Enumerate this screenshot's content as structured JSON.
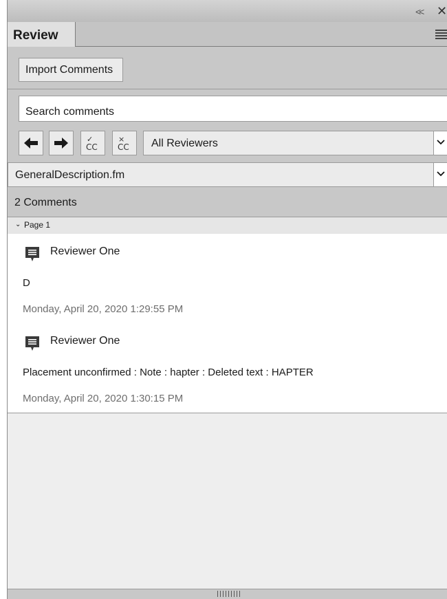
{
  "window": {
    "collapse_glyph": "<<",
    "close_glyph": "✕"
  },
  "tabs": {
    "active": "Review"
  },
  "toolbar": {
    "import_label": "Import Comments"
  },
  "search": {
    "placeholder": "Search comments"
  },
  "nav": {
    "prev_icon": "arrow-left-icon",
    "next_icon": "arrow-right-icon",
    "accept_icon": "accept-change-icon",
    "reject_icon": "reject-change-icon",
    "check_glyph": "✓",
    "x_glyph": "×",
    "cc_text": "CC"
  },
  "filters": {
    "reviewer_selected": "All Reviewers",
    "file_selected": "GeneralDescription.fm"
  },
  "summary": {
    "count_label": "2 Comments"
  },
  "page_group": {
    "chevron": "⌄",
    "label": "Page 1"
  },
  "comments": [
    {
      "author": "Reviewer One",
      "text": "D",
      "date": "Monday, April 20, 2020 1:29:55 PM"
    },
    {
      "author": "Reviewer One",
      "text": "Placement unconfirmed : Note : hapter : Deleted text : HAPTER",
      "date": "Monday, April 20, 2020 1:30:15 PM"
    }
  ],
  "colors": {
    "panel_bg": "#c8c8c8",
    "icon_fill": "#3a3a3a",
    "date_text": "#6e6e6e"
  }
}
